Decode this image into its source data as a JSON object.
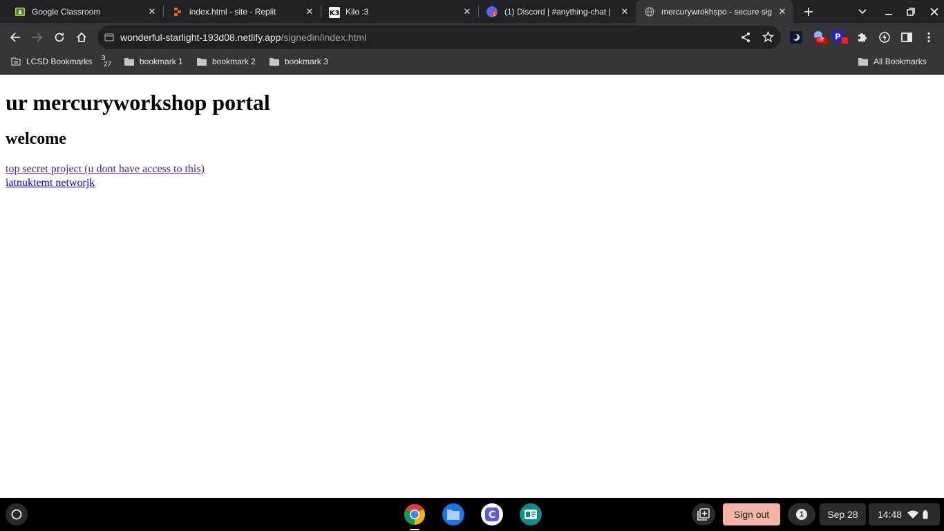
{
  "tabs": [
    {
      "title": "Google Classroom",
      "icon": "google-classroom-icon"
    },
    {
      "title": "index.html - site - Replit",
      "icon": "replit-icon"
    },
    {
      "title": "Kilo :3",
      "icon": "kilo-icon"
    },
    {
      "title": "(1) Discord | #anything-chat |",
      "icon": "discord-icon"
    },
    {
      "title": "mercurywrokhspo - secure sig",
      "icon": "globe-icon",
      "active": true
    }
  ],
  "address": {
    "host": "wonderful-starlight-193d08.netlify.app",
    "path": "/signedin/index.html"
  },
  "extensions": {
    "off_badge": "off"
  },
  "bookmarks": {
    "lcsd": "LCSD Bookmarks",
    "counter_top": "3",
    "counter_bottom": "27",
    "items": [
      "bookmark 1",
      "bookmark 2",
      "bookmark 3"
    ],
    "all": "All Bookmarks"
  },
  "page": {
    "title": "ur mercuryworkshop portal",
    "subtitle": "welcome",
    "links": [
      "top secret project (u dont have access to this)",
      "iatnuktemt networjk"
    ]
  },
  "shelf": {
    "signout": "Sign out",
    "notification_count": "1",
    "date": "Sep 28",
    "time": "14:48"
  },
  "colors": {
    "visited_link": "#551a8b",
    "link": "#0000ee",
    "signout_bg": "#f3b3a5"
  }
}
